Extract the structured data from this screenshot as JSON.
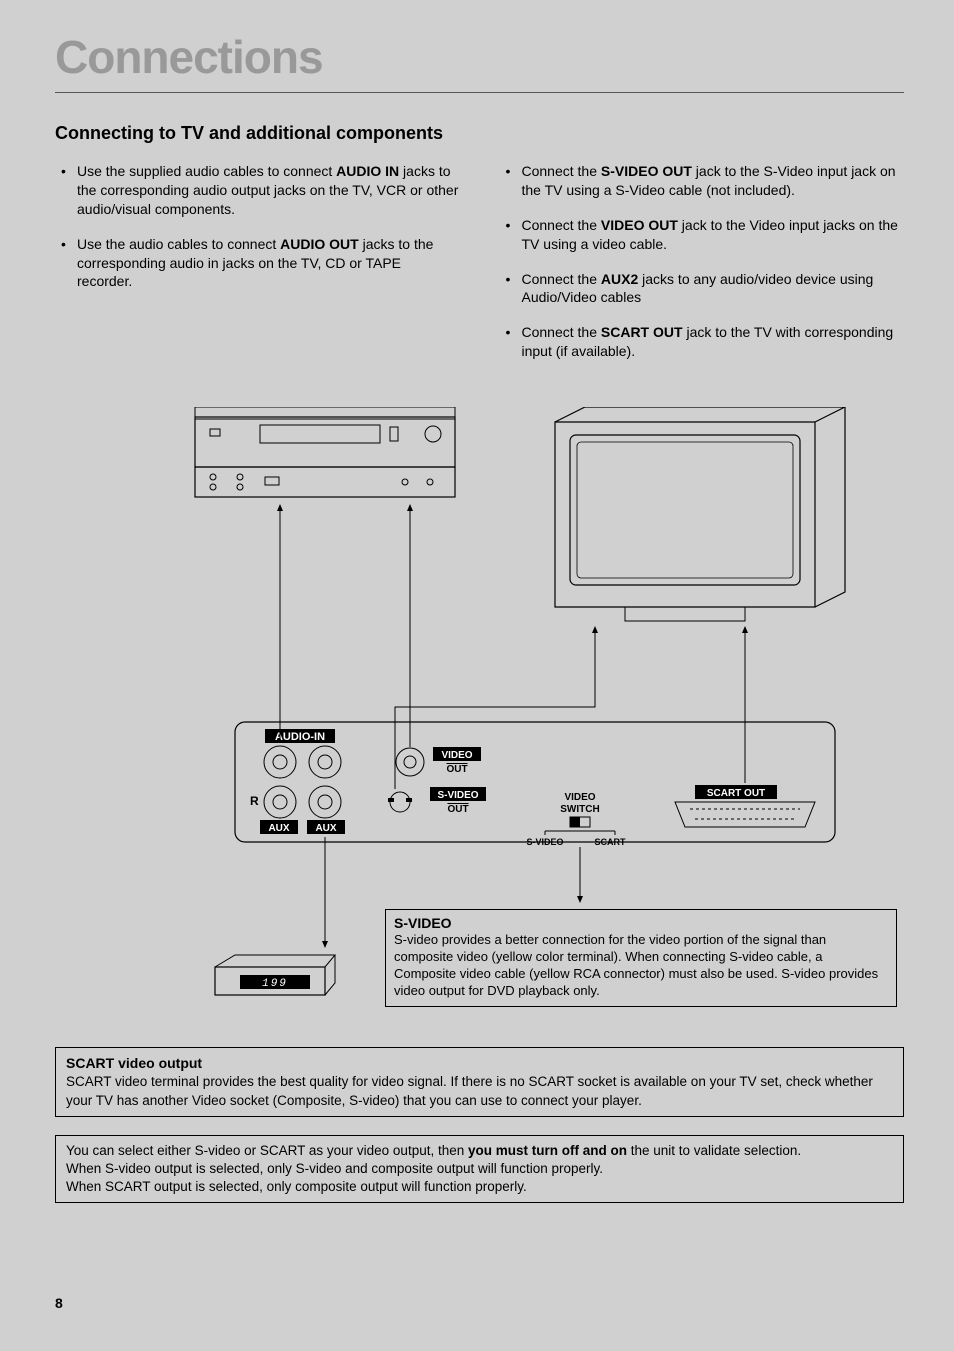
{
  "title": "Connections",
  "subtitle": "Connecting to TV and additional components",
  "left_bullets": [
    {
      "pre": "Use the supplied audio cables to connect ",
      "bold": "AUDIO IN",
      "post": " jacks to the corresponding audio output jacks on the TV, VCR or other audio/visual components."
    },
    {
      "pre": "Use the audio cables to connect ",
      "bold": "AUDIO OUT",
      "post": " jacks to the corresponding audio in jacks on the TV, CD or TAPE recorder."
    }
  ],
  "right_bullets": [
    {
      "pre": "Connect the ",
      "bold": "S-VIDEO OUT",
      "post": " jack to the S-Video input jack on the TV using a S-Video cable (not included)."
    },
    {
      "pre": "Connect the ",
      "bold": "VIDEO OUT",
      "post": " jack to the Video input jacks on the TV using a video cable."
    },
    {
      "pre": "Connect the ",
      "bold": "AUX2",
      "post": " jacks to any audio/video device using Audio/Video cables"
    },
    {
      "pre": "Connect the ",
      "bold": "SCART OUT",
      "post": " jack to the TV with corresponding input (if available)."
    }
  ],
  "diagram_labels": {
    "audio_in": "AUDIO-IN",
    "video_out_1": "VIDEO",
    "video_out_2": "OUT",
    "svideo_1": "S-VIDEO",
    "svideo_2": "OUT",
    "r": "R",
    "aux1": "AUX",
    "aux2": "AUX",
    "video_switch_1": "VIDEO",
    "video_switch_2": "SWITCH",
    "svideo_sw": "S-VIDEO",
    "scart_sw": "SCART",
    "scart_out": "SCART OUT",
    "display": "199"
  },
  "svideo_box": {
    "title": "S-VIDEO",
    "body": "S-video provides a better connection for the video portion of the signal than composite video (yellow color terminal). When connecting S-video cable, a Composite video cable (yellow RCA connector) must also be used. S-video provides video output for DVD playback only."
  },
  "scart_box": {
    "title": "SCART video output",
    "body": "SCART video terminal provides the best quality for video signal. If there is no SCART socket is available on your TV set, check whether your TV has another Video socket (Composite, S-video) that you can use to connect your player."
  },
  "note_box": {
    "line1_pre": "You can select either S-video or SCART as your video output, then ",
    "line1_bold": "you must turn off and on",
    "line1_post": " the unit to validate selection.",
    "line2": "When S-video output is selected, only S-video and composite output will function properly.",
    "line3": "When SCART output is selected, only composite output will function properly."
  },
  "page_number": "8"
}
